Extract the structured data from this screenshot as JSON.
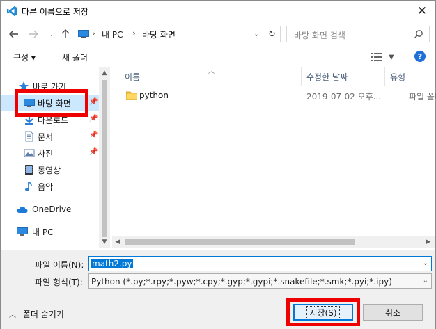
{
  "window": {
    "title": "다른 이름으로 저장"
  },
  "nav": {
    "back_icon": "arrow-left-icon",
    "forward_icon": "arrow-right-icon",
    "recent_icon": "chevron-down-icon",
    "up_icon": "arrow-up-icon"
  },
  "address": {
    "segments": [
      "내 PC",
      "바탕 화면"
    ],
    "separator": "›"
  },
  "search": {
    "placeholder": "바탕 화면 검색"
  },
  "toolbar": {
    "organize_label": "구성 ▾",
    "new_folder_label": "새 폴더",
    "help_label": "?"
  },
  "sidebar": {
    "items": [
      {
        "label": "바로 가기",
        "icon": "star-icon"
      },
      {
        "label": "바탕 화면",
        "icon": "desktop-icon",
        "selected": true,
        "pinned": true
      },
      {
        "label": "다운로드",
        "icon": "download-icon",
        "pinned": true
      },
      {
        "label": "문서",
        "icon": "document-icon",
        "pinned": true
      },
      {
        "label": "사진",
        "icon": "pictures-icon",
        "pinned": true
      },
      {
        "label": "동영상",
        "icon": "video-icon"
      },
      {
        "label": "음악",
        "icon": "music-icon"
      },
      {
        "label": "OneDrive",
        "icon": "cloud-icon"
      },
      {
        "label": "내 PC",
        "icon": "computer-icon"
      }
    ]
  },
  "file_list": {
    "columns": [
      "이름",
      "수정한 날짜",
      "유형"
    ],
    "rows": [
      {
        "name": "python",
        "modified": "2019-07-02 오후...",
        "type": "파일 폴더"
      }
    ]
  },
  "form": {
    "filename_label": "파일 이름(N):",
    "filename_value": "math2.py",
    "filetype_label": "파일 형식(T):",
    "filetype_value": "Python (*.py;*.rpy;*.pyw;*.cpy;*.gyp;*.gypi;*.snakefile;*.smk;*.pyi;*.ipy)"
  },
  "footer": {
    "hide_folders_label": "폴더 숨기기",
    "save_label": "저장(S)",
    "cancel_label": "취소"
  },
  "colors": {
    "accent": "#0078d7",
    "selection": "#cce8ff",
    "highlight_box": "#ee0000",
    "help": "#1e6fd6"
  }
}
